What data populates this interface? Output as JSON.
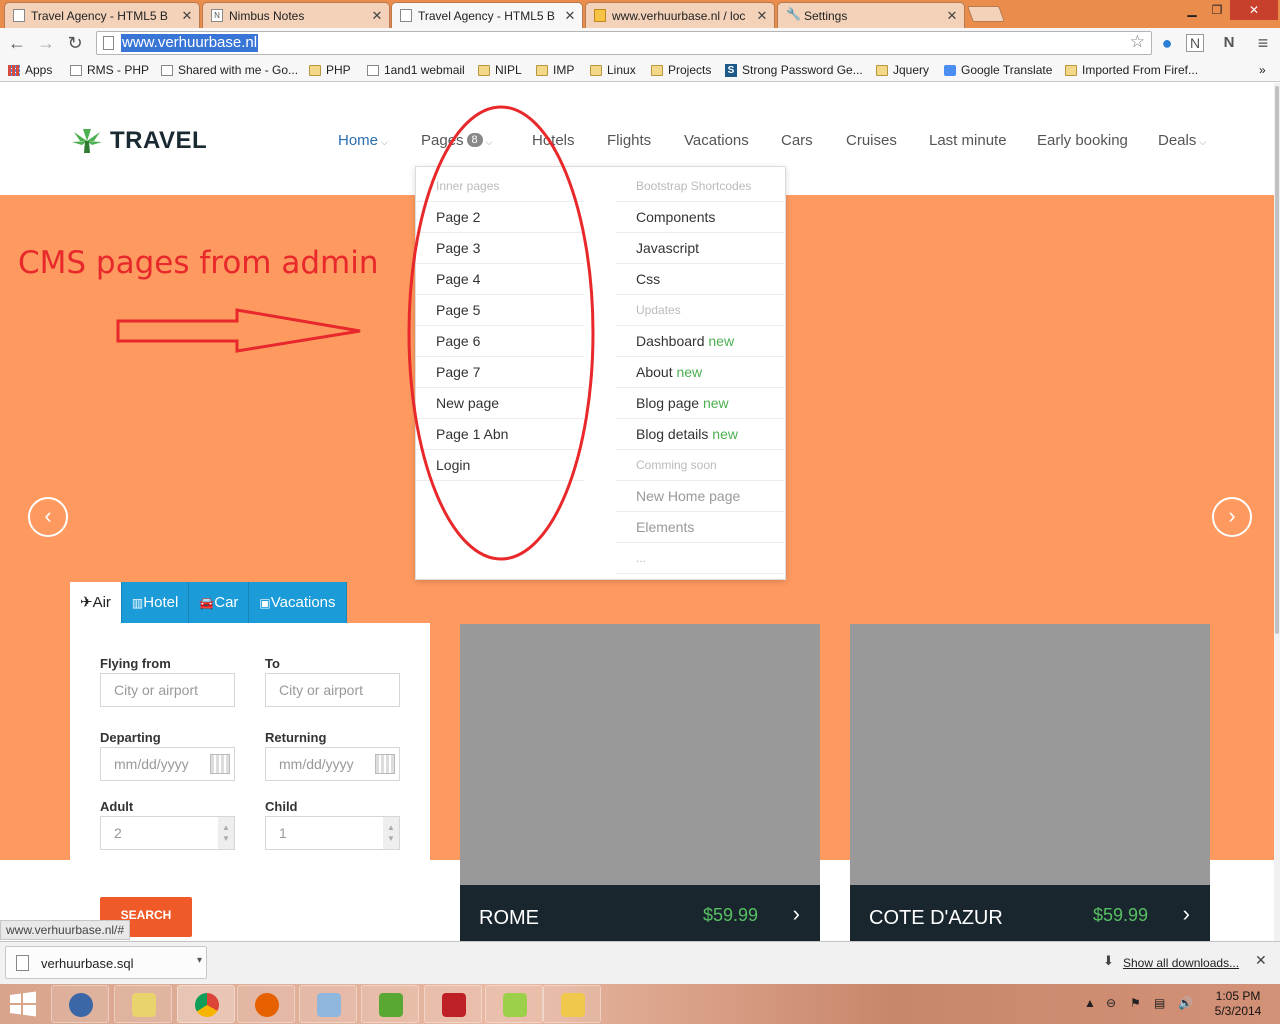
{
  "browser": {
    "tabs": [
      {
        "title": "Travel Agency - HTML5 B",
        "icon": "page-icon",
        "active": false
      },
      {
        "title": "Nimbus Notes",
        "icon": "nimbus-icon",
        "active": false
      },
      {
        "title": "Travel Agency - HTML5 B",
        "icon": "page-icon",
        "active": true
      },
      {
        "title": "www.verhuurbase.nl / loc",
        "icon": "phpmyadmin-icon",
        "active": false
      },
      {
        "title": "Settings",
        "icon": "wrench-icon",
        "active": false
      }
    ],
    "url": "www.verhuurbase.nl",
    "apps_label": "Apps",
    "bookmarks": [
      {
        "label": "RMS - PHP",
        "icon": "page"
      },
      {
        "label": "Shared with me - Go...",
        "icon": "page"
      },
      {
        "label": "PHP",
        "icon": "folder"
      },
      {
        "label": "1and1 webmail",
        "icon": "page"
      },
      {
        "label": "NIPL",
        "icon": "folder"
      },
      {
        "label": "IMP",
        "icon": "folder"
      },
      {
        "label": "Linux",
        "icon": "folder"
      },
      {
        "label": "Projects",
        "icon": "folder"
      },
      {
        "label": "Strong Password Ge...",
        "icon": "s-logo"
      },
      {
        "label": "Jquery",
        "icon": "folder"
      },
      {
        "label": "Google Translate",
        "icon": "translate"
      },
      {
        "label": "Imported From Firef...",
        "icon": "folder"
      }
    ]
  },
  "site": {
    "logo": "TRAVEL",
    "nav": [
      {
        "label": "Home",
        "caret": true,
        "active": true
      },
      {
        "label": "Pages",
        "caret": true,
        "badge": "8"
      },
      {
        "label": "Hotels"
      },
      {
        "label": "Flights"
      },
      {
        "label": "Vacations"
      },
      {
        "label": "Cars"
      },
      {
        "label": "Cruises"
      },
      {
        "label": "Last minute"
      },
      {
        "label": "Early booking"
      },
      {
        "label": "Deals",
        "caret": true
      }
    ],
    "dropdown": {
      "left": [
        {
          "label": "Inner pages",
          "type": "head"
        },
        {
          "label": "Page 2"
        },
        {
          "label": "Page 3"
        },
        {
          "label": "Page 4"
        },
        {
          "label": "Page 5"
        },
        {
          "label": "Page 6"
        },
        {
          "label": "Page 7"
        },
        {
          "label": "New page"
        },
        {
          "label": "Page 1 Abn"
        },
        {
          "label": "Login"
        }
      ],
      "right": [
        {
          "label": "Bootstrap Shortcodes",
          "type": "head"
        },
        {
          "label": "Components"
        },
        {
          "label": "Javascript"
        },
        {
          "label": "Css"
        },
        {
          "label": "Updates",
          "type": "head"
        },
        {
          "label": "Dashboard",
          "new": "new"
        },
        {
          "label": "About",
          "new": "new"
        },
        {
          "label": "Blog page",
          "new": "new"
        },
        {
          "label": "Blog details",
          "new": "new"
        },
        {
          "label": "Comming soon",
          "type": "head"
        },
        {
          "label": "New Home page",
          "type": "muted"
        },
        {
          "label": "Elements",
          "type": "muted"
        },
        {
          "label": "...",
          "type": "head"
        }
      ]
    },
    "annotation": "CMS pages from admin",
    "search": {
      "tabs": [
        "Air",
        "Hotel",
        "Car",
        "Vacations"
      ],
      "flying_from_label": "Flying from",
      "to_label": "To",
      "city_placeholder": "City or airport",
      "departing_label": "Departing",
      "returning_label": "Returning",
      "date_placeholder": "mm/dd/yyyy",
      "adult_label": "Adult",
      "child_label": "Child",
      "adult_value": "2",
      "child_value": "1",
      "button": "SEARCH"
    },
    "deals": [
      {
        "name": "ROME",
        "price": "$59.99"
      },
      {
        "name": "COTE D'AZUR",
        "price": "$59.99"
      }
    ],
    "status_url": "www.verhuurbase.nl/#"
  },
  "downloads": {
    "file": "verhuurbase.sql",
    "show_all": "Show all downloads..."
  },
  "taskbar": {
    "apps": [
      "thunderbird",
      "file-manager",
      "chrome",
      "firefox",
      "virtualbox",
      "evernote",
      "filezilla",
      "notepad",
      "explorer"
    ],
    "time": "1:05 PM",
    "date": "5/3/2014"
  },
  "colors": {
    "hero": "#fe9960",
    "annotation": "#e8282a",
    "search_tab": "#1b9bd8",
    "search_button": "#f05a28",
    "price": "#57c062",
    "deal_bar": "#19262e",
    "new_badge": "#4caf50"
  }
}
